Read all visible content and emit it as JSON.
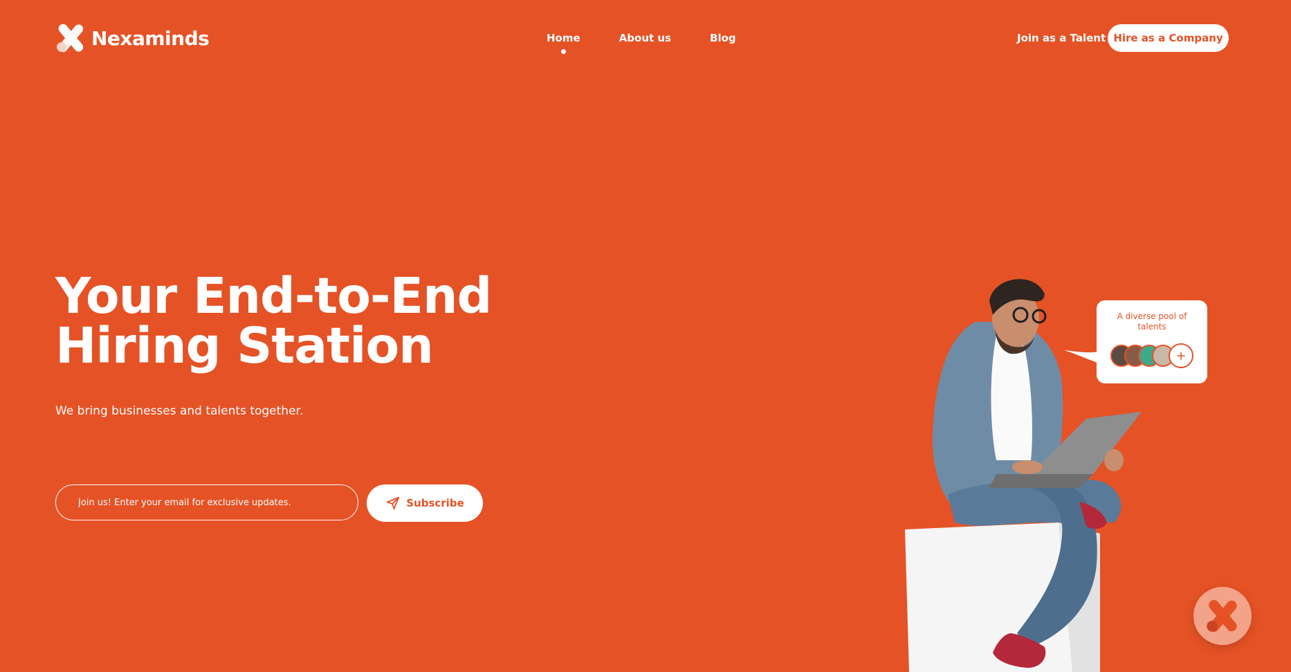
{
  "brand": {
    "name": "Nexaminds",
    "logo_icon": "x-logo-icon"
  },
  "nav": {
    "items": [
      {
        "label": "Home",
        "active": true
      },
      {
        "label": "About us",
        "active": false
      },
      {
        "label": "Blog",
        "active": false
      }
    ],
    "join_talent_label": "Join as a Talent",
    "hire_company_label": "Hire as a Company"
  },
  "hero": {
    "title_line1": "Your End-to-End",
    "title_line2": "Hiring Station",
    "subtitle": "We bring businesses and talents together.",
    "email_placeholder": "Join us! Enter your email for exclusive updates.",
    "subscribe_label": "Subscribe",
    "subscribe_icon": "send-icon"
  },
  "talent_bubble": {
    "text": "A diverse pool of talents",
    "more_symbol": "+"
  },
  "chat_widget": {
    "icon": "x-logo-icon"
  },
  "colors": {
    "background": "#E55225",
    "accent": "#E55225",
    "white": "#FFFFFF",
    "widget": "#F3A38A"
  }
}
